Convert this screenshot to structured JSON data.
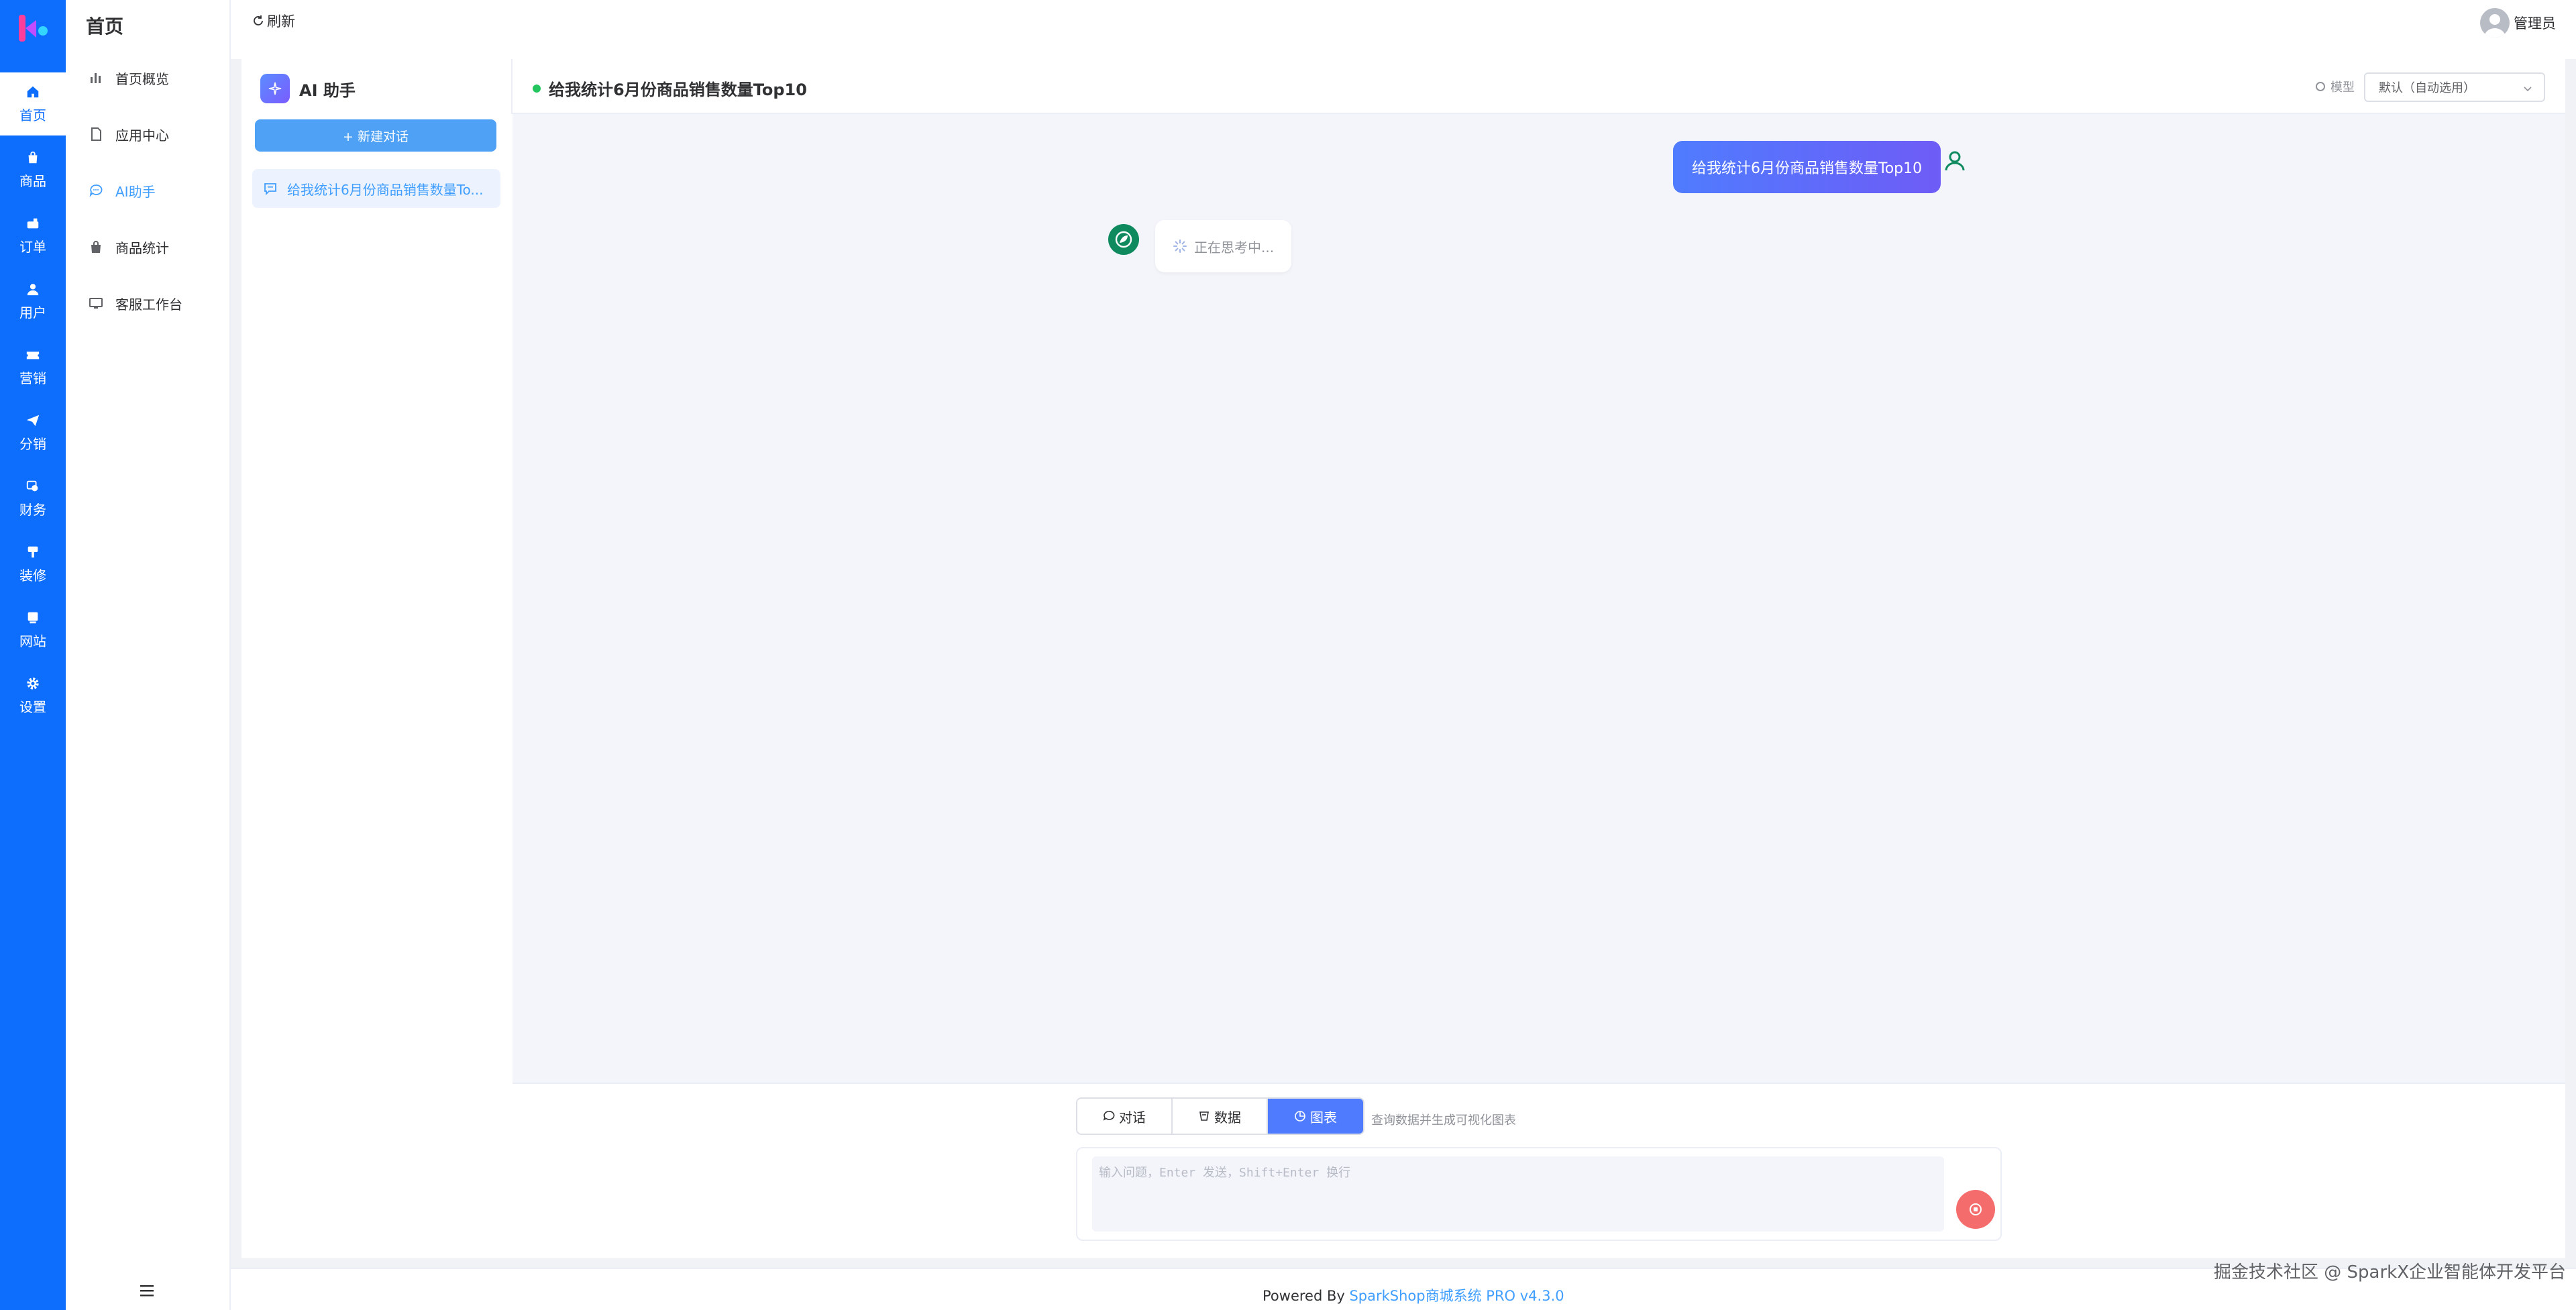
{
  "rail": {
    "items": [
      {
        "label": "首页",
        "icon": "home-icon"
      },
      {
        "label": "商品",
        "icon": "bag-icon"
      },
      {
        "label": "订单",
        "icon": "order-icon"
      },
      {
        "label": "用户",
        "icon": "user-icon"
      },
      {
        "label": "营销",
        "icon": "ticket-icon"
      },
      {
        "label": "分销",
        "icon": "send-icon"
      },
      {
        "label": "财务",
        "icon": "money-icon"
      },
      {
        "label": "装修",
        "icon": "brush-icon"
      },
      {
        "label": "网站",
        "icon": "site-icon"
      },
      {
        "label": "设置",
        "icon": "gear-icon"
      }
    ]
  },
  "subnav": {
    "title": "首页",
    "items": [
      {
        "label": "首页概览",
        "icon": "bar-chart-icon"
      },
      {
        "label": "应用中心",
        "icon": "document-icon"
      },
      {
        "label": "AI助手",
        "icon": "chat-icon"
      },
      {
        "label": "商品统计",
        "icon": "shopping-bag-icon"
      },
      {
        "label": "客服工作台",
        "icon": "monitor-icon"
      }
    ]
  },
  "topbar": {
    "refresh_label": "刷新",
    "user_name": "管理员"
  },
  "ai_panel": {
    "title": "AI 助手",
    "new_chat_label": "+ 新建对话",
    "conversations": [
      {
        "title": "给我统计6月份商品销售数量To..."
      }
    ]
  },
  "chat": {
    "title": "给我统计6月份商品销售数量Top10",
    "model_label": "模型",
    "model_value": "默认（自动选用）",
    "messages": {
      "user": "给我统计6月份商品销售数量Top10",
      "bot_status": "正在思考中..."
    },
    "modes": [
      {
        "label": "对话",
        "icon": "chat-bubble-icon"
      },
      {
        "label": "数据",
        "icon": "database-icon"
      },
      {
        "label": "图表",
        "icon": "pie-chart-icon"
      }
    ],
    "mode_hint": "查询数据并生成可视化图表",
    "input_placeholder": "输入问题，Enter 发送，Shift+Enter 换行"
  },
  "footer": {
    "prefix": "Powered By ",
    "link": "SparkShop商城系统 PRO v4.3.0"
  },
  "watermark": "掘金技术社区 @ SparkX企业智能体开发平台",
  "colors": {
    "brand": "#0d6efd",
    "accent": "#4f7cff",
    "link": "#409eff",
    "send": "#f56c6c",
    "status": "#22c55e"
  }
}
